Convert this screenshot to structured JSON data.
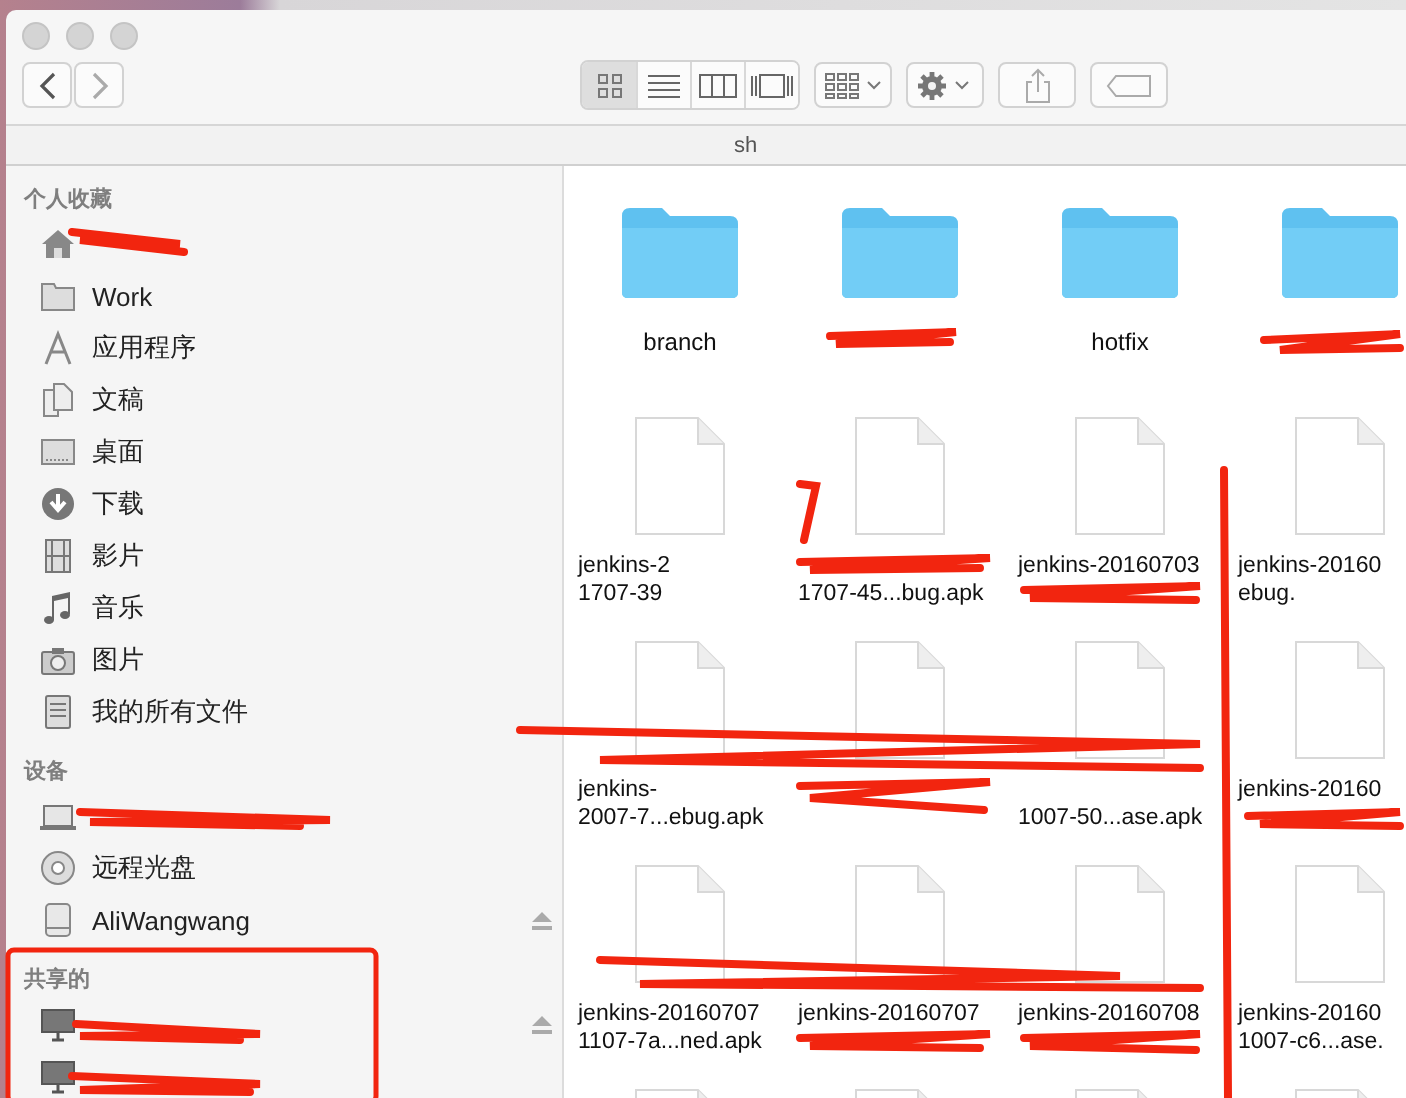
{
  "window": {
    "title": "sh"
  },
  "toolbar": {
    "view_modes": [
      {
        "selected": true
      },
      {
        "selected": false
      },
      {
        "selected": false
      },
      {
        "selected": false
      }
    ]
  },
  "sidebar": {
    "sections": [
      {
        "title": "个人收藏",
        "items": [
          {
            "kind": "home"
          },
          {
            "kind": "folder",
            "label": "Work"
          },
          {
            "kind": "apps",
            "label": "应用程序"
          },
          {
            "kind": "docs",
            "label": "文稿"
          },
          {
            "kind": "desktop",
            "label": "桌面"
          },
          {
            "kind": "download",
            "label": "下载"
          },
          {
            "kind": "movies",
            "label": "影片"
          },
          {
            "kind": "music",
            "label": "音乐"
          },
          {
            "kind": "pictures",
            "label": "图片"
          },
          {
            "kind": "allfiles",
            "label": "我的所有文件"
          }
        ]
      },
      {
        "title": "设备",
        "items": [
          {
            "kind": "laptop",
            "ejectable": false
          },
          {
            "kind": "disc",
            "label": "远程光盘",
            "ejectable": false
          },
          {
            "kind": "drive",
            "label": "AliWangwang",
            "ejectable": true
          }
        ]
      },
      {
        "title": "共享的",
        "items": [
          {
            "kind": "monitor",
            "ejectable": true
          },
          {
            "kind": "monitor",
            "ejectable": false
          }
        ]
      }
    ]
  },
  "files": [
    {
      "kind": "folder",
      "name": "branch"
    },
    {
      "kind": "folder"
    },
    {
      "kind": "folder",
      "name": "hotfix"
    },
    {
      "kind": "folder"
    },
    {
      "kind": "file",
      "top_line": "jenkins-2",
      "bottom_line": "1707-39"
    },
    {
      "kind": "file",
      "bottom_line": "1707-45...bug.apk"
    },
    {
      "kind": "file",
      "top_line": "jenkins-20160703"
    },
    {
      "kind": "file",
      "top_line": "jenkins-20160",
      "bottom_line": "ebug."
    },
    {
      "kind": "file",
      "top_line": "jenkins-",
      "bottom_line": "2007-7...ebug.apk"
    },
    {
      "kind": "file"
    },
    {
      "kind": "file",
      "bottom_line": "1007-50...ase.apk"
    },
    {
      "kind": "file",
      "top_line": "jenkins-20160"
    },
    {
      "kind": "file",
      "top_line": "jenkins-20160707",
      "bottom_line": "1107-7a...ned.apk"
    },
    {
      "kind": "file",
      "top_line": "jenkins-20160707"
    },
    {
      "kind": "file",
      "top_line": "jenkins-20160708"
    },
    {
      "kind": "file",
      "top_line": "jenkins-20160",
      "bottom_line": "1007-c6...ase."
    },
    {
      "kind": "file"
    },
    {
      "kind": "file"
    },
    {
      "kind": "file"
    },
    {
      "kind": "file"
    }
  ]
}
